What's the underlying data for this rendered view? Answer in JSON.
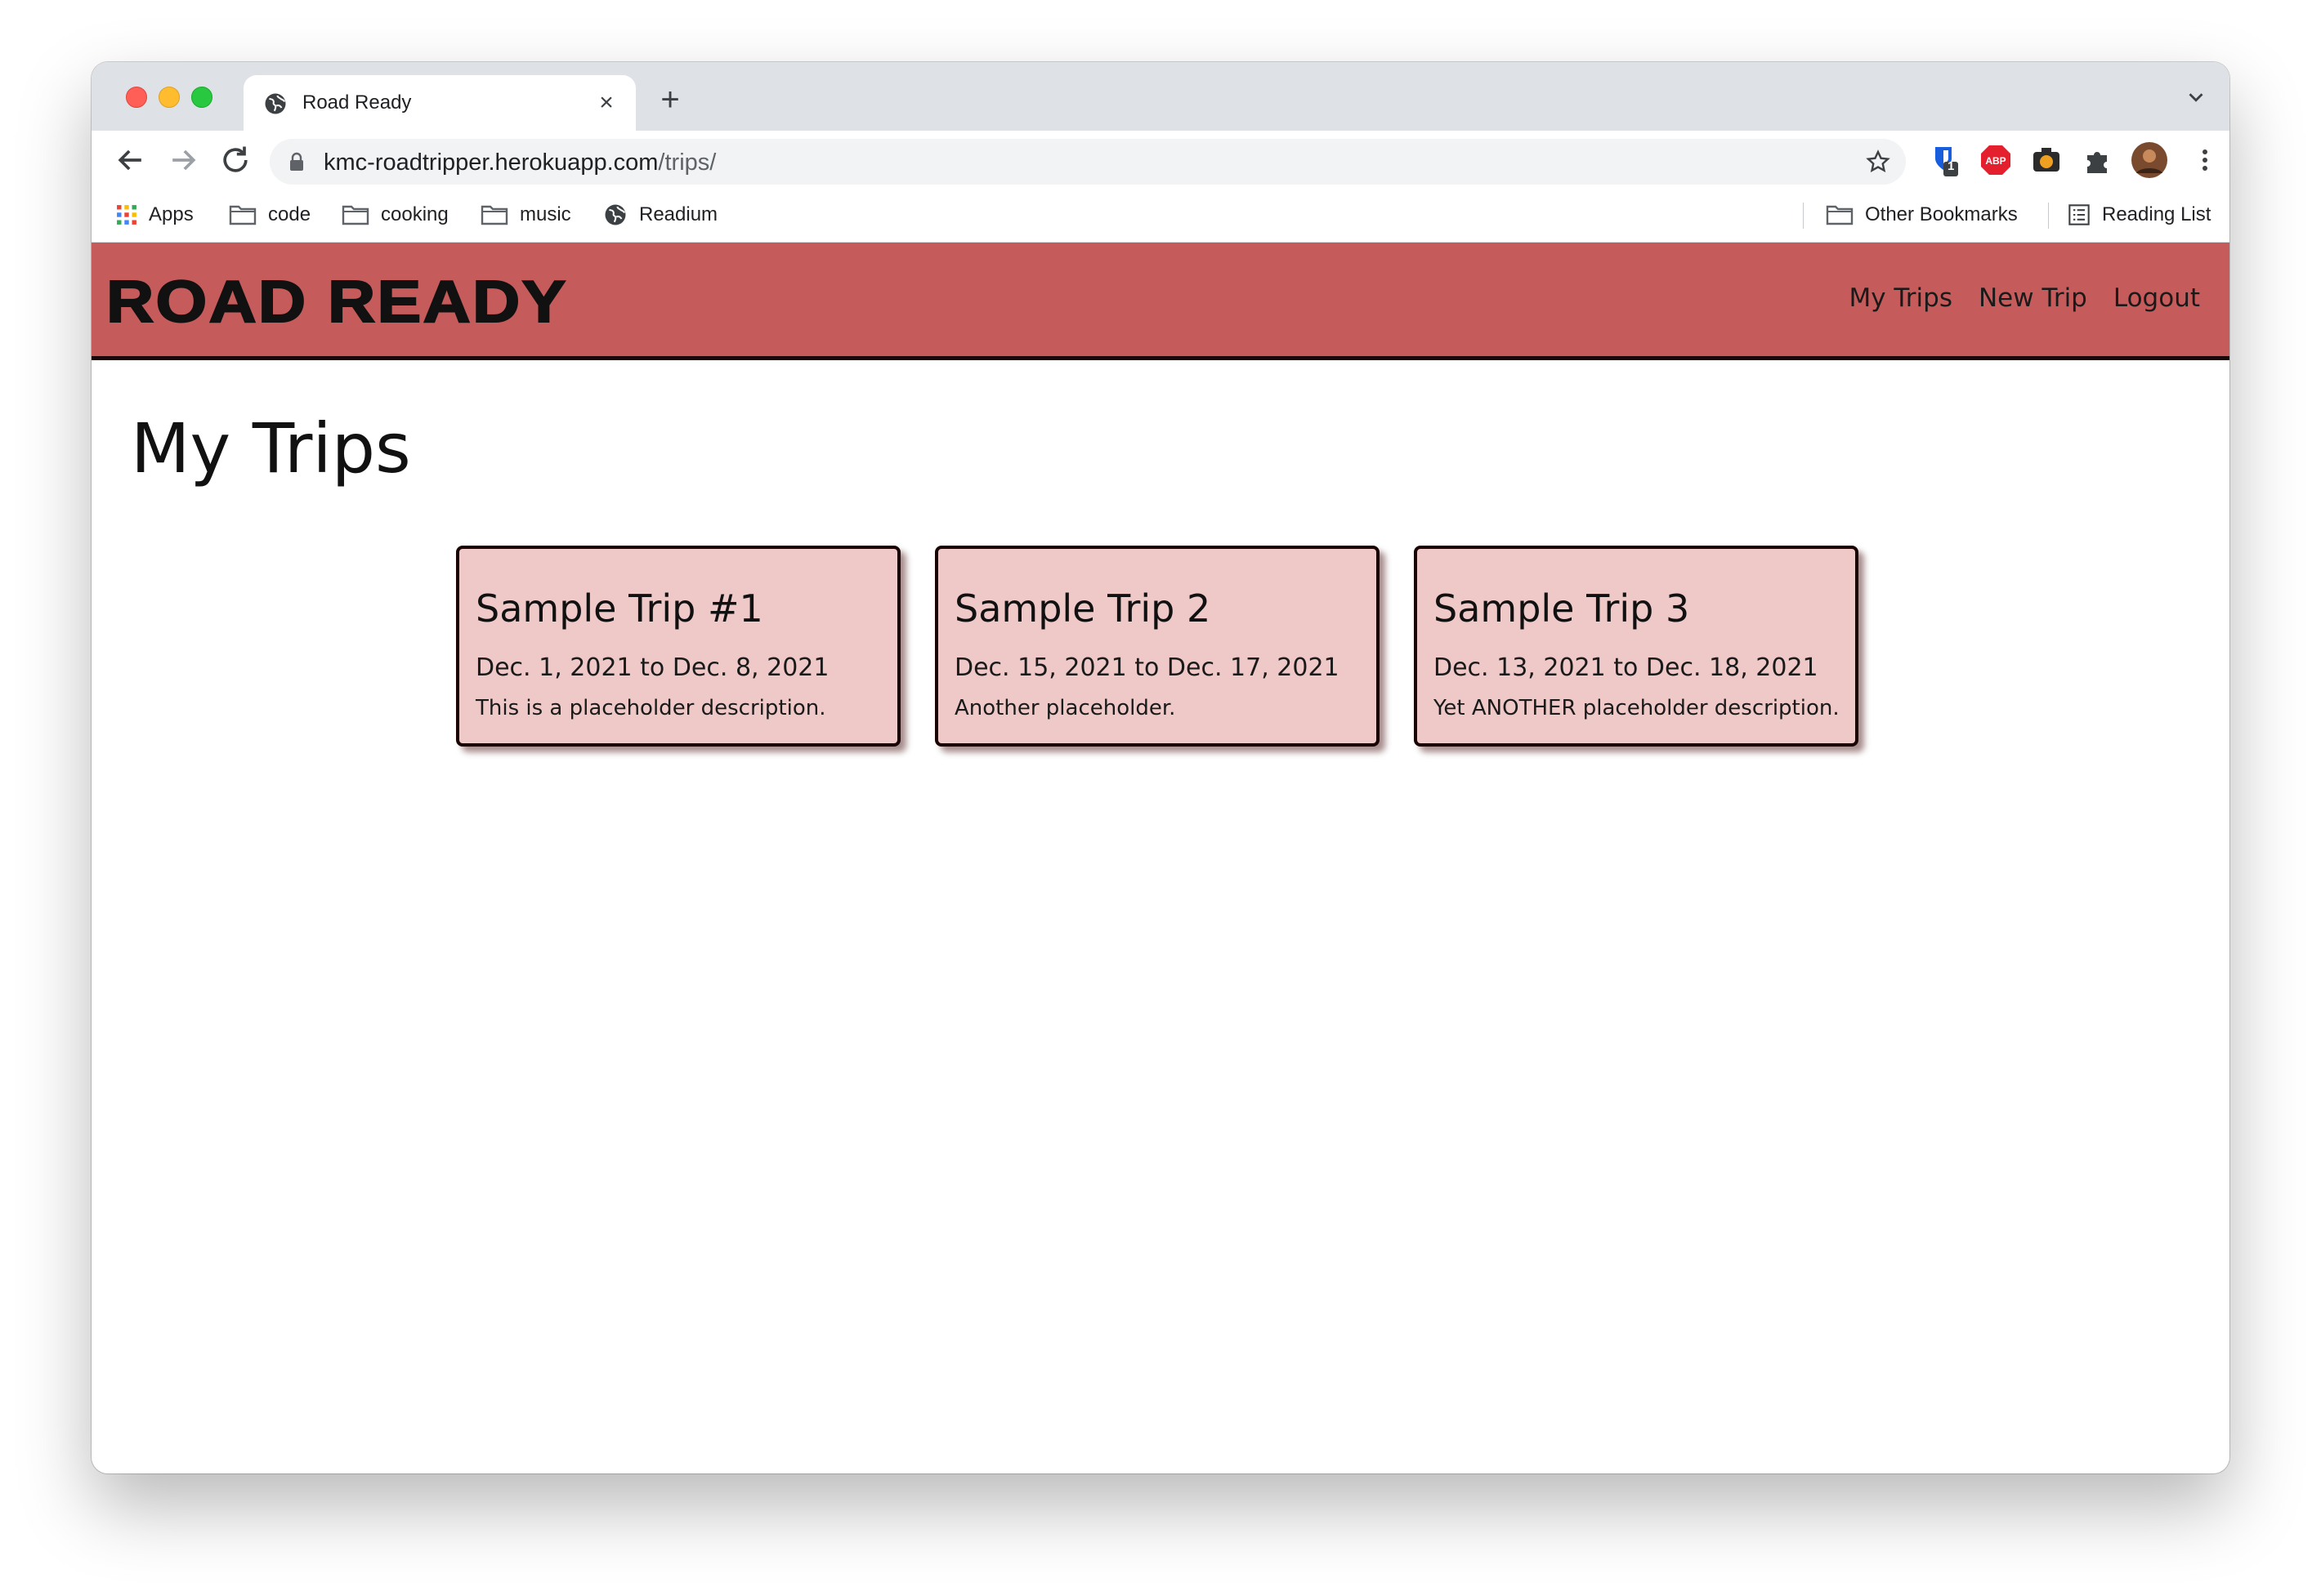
{
  "browser": {
    "tab_title": "Road Ready",
    "url_host": "kmc-roadtripper.herokuapp.com",
    "url_path": "/trips/",
    "extension_badge": "1",
    "bookmarks": [
      {
        "label": "Apps",
        "icon": "apps-grid-icon"
      },
      {
        "label": "code",
        "icon": "folder-icon"
      },
      {
        "label": "cooking",
        "icon": "folder-icon"
      },
      {
        "label": "music",
        "icon": "folder-icon"
      },
      {
        "label": "Readium",
        "icon": "globe-icon"
      }
    ],
    "other_bookmarks": "Other Bookmarks",
    "reading_list": "Reading List"
  },
  "site": {
    "logo": "ROAD READY",
    "nav": [
      {
        "label": "My Trips"
      },
      {
        "label": "New Trip"
      },
      {
        "label": "Logout"
      }
    ],
    "header_color": "#c65b5b"
  },
  "page": {
    "title": "My Trips",
    "trips": [
      {
        "title": "Sample Trip #1",
        "dates": "Dec. 1, 2021 to Dec. 8, 2021",
        "description": "This is a placeholder description."
      },
      {
        "title": "Sample Trip 2",
        "dates": "Dec. 15, 2021 to Dec. 17, 2021",
        "description": "Another placeholder."
      },
      {
        "title": "Sample Trip 3",
        "dates": "Dec. 13, 2021 to Dec. 18, 2021",
        "description": "Yet ANOTHER placeholder description."
      }
    ],
    "card_color": "#efc8c8"
  }
}
